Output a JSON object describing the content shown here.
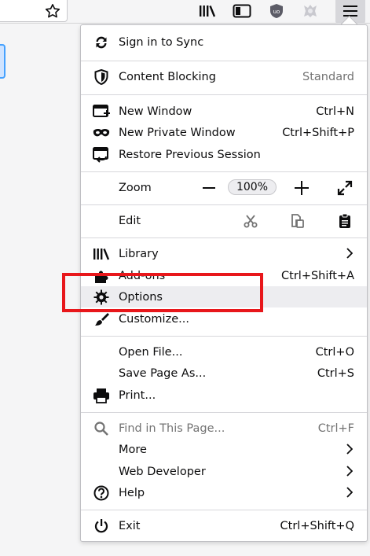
{
  "toolbar": {
    "icons": [
      "star-icon",
      "library-icon",
      "sidebar-icon",
      "ublock-icon",
      "extension-icon",
      "hamburger-menu-icon"
    ]
  },
  "menu": {
    "sync": {
      "label": "Sign in to Sync",
      "icon": "sync-icon"
    },
    "content_blocking": {
      "label": "Content Blocking",
      "value": "Standard",
      "icon": "shield-icon"
    },
    "new_window": {
      "label": "New Window",
      "shortcut": "Ctrl+N",
      "icon": "new-window-icon"
    },
    "new_private_window": {
      "label": "New Private Window",
      "shortcut": "Ctrl+Shift+P",
      "icon": "private-mask-icon"
    },
    "restore_session": {
      "label": "Restore Previous Session",
      "icon": "restore-session-icon"
    },
    "zoom": {
      "label": "Zoom",
      "value": "100%",
      "minus": "−",
      "plus": "+"
    },
    "edit": {
      "label": "Edit",
      "actions": [
        "cut-icon",
        "copy-icon",
        "paste-icon"
      ]
    },
    "library": {
      "label": "Library",
      "icon": "library-icon"
    },
    "addons": {
      "label": "Add-ons",
      "shortcut": "Ctrl+Shift+A",
      "icon": "puzzle-icon"
    },
    "options": {
      "label": "Options",
      "icon": "gear-icon"
    },
    "customize": {
      "label": "Customize...",
      "icon": "paintbrush-icon"
    },
    "open_file": {
      "label": "Open File...",
      "shortcut": "Ctrl+O"
    },
    "save_page": {
      "label": "Save Page As...",
      "shortcut": "Ctrl+S"
    },
    "print": {
      "label": "Print...",
      "icon": "printer-icon"
    },
    "find": {
      "label": "Find in This Page...",
      "shortcut": "Ctrl+F",
      "icon": "search-icon"
    },
    "more": {
      "label": "More"
    },
    "web_developer": {
      "label": "Web Developer"
    },
    "help": {
      "label": "Help",
      "icon": "help-icon"
    },
    "exit": {
      "label": "Exit",
      "shortcut": "Ctrl+Shift+Q",
      "icon": "power-icon"
    }
  },
  "colors": {
    "highlight_box": "#e8171b",
    "hover_row": "#ededf0",
    "disabled_text": "#737373"
  }
}
